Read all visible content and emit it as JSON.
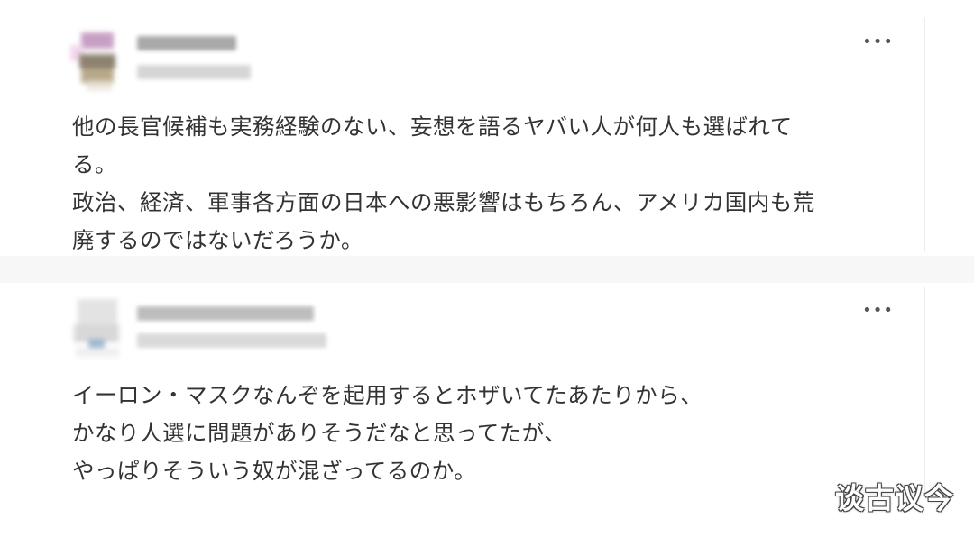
{
  "posts": [
    {
      "more_label": "•••",
      "lines": [
        "他の長官候補も実務経験のない、妄想を語るヤバい人が何人も選ばれて",
        "る。",
        "政治、経済、軍事各方面の日本への悪影響はもちろん、アメリカ国内も荒",
        "廃するのではないだろうか。"
      ]
    },
    {
      "more_label": "•••",
      "lines": [
        "イーロン・マスクなんぞを起用するとホザいてたあたりから、",
        "かなり人選に問題がありそうだなと思ってたが、",
        "やっぱりそういう奴が混ざってるのか。"
      ]
    }
  ],
  "watermark": "谈古议今"
}
